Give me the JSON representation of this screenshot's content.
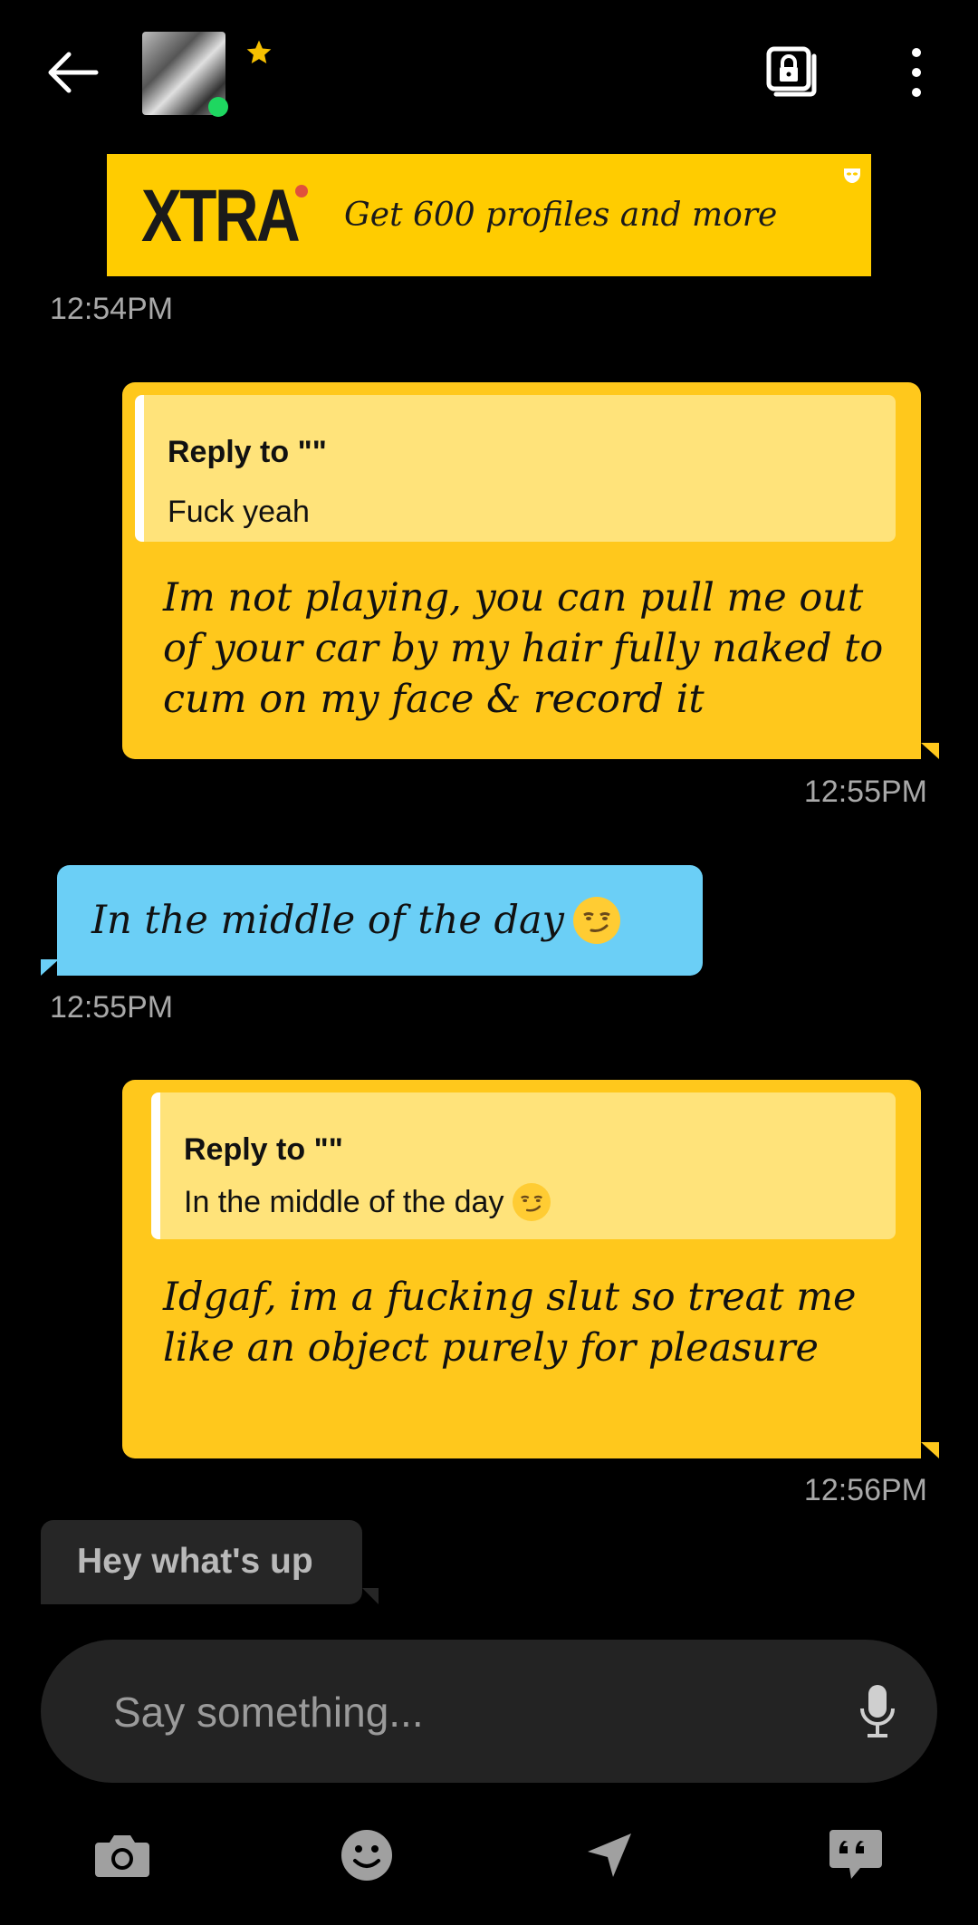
{
  "header": {
    "back_icon": "arrow-left-icon",
    "online_status_color": "#1ed760",
    "favorite_icon": "star-icon",
    "favorite_color": "#f7c000",
    "album_icon": "locked-album-icon",
    "more_icon": "more-vertical-icon"
  },
  "ad": {
    "logo": "XTRA",
    "text": "Get 600 profiles and more",
    "background": "#ffcc00"
  },
  "messages": [
    {
      "type": "ad_timestamp",
      "timestamp": "12:54PM"
    },
    {
      "direction": "outgoing",
      "reply_title": "Reply to \"\"",
      "reply_text": "Fuck yeah",
      "text": "Im not playing, you can pull me out of your car by my hair fully naked to cum on my face & record it",
      "timestamp": "12:55PM",
      "color": "#ffc81c"
    },
    {
      "direction": "incoming",
      "text": "In the middle of the day",
      "emoji": "smirk-emoji",
      "timestamp": "12:55PM",
      "color": "#6bcff6"
    },
    {
      "direction": "outgoing",
      "reply_title": "Reply to \"\"",
      "reply_text": "In the middle of the day",
      "reply_emoji": "smirk-emoji",
      "text": "Idgaf, im a fucking slut so treat me like an object purely for pleasure",
      "timestamp": "12:56PM",
      "color": "#ffc81c"
    },
    {
      "direction": "incoming",
      "text": "Hey what's up",
      "color": "#262626"
    }
  ],
  "composer": {
    "placeholder": "Say something...",
    "mic_icon": "microphone-icon"
  },
  "toolbar": {
    "items": [
      {
        "icon": "camera-icon"
      },
      {
        "icon": "smiley-icon"
      },
      {
        "icon": "location-arrow-icon"
      },
      {
        "icon": "saved-phrases-icon"
      }
    ]
  }
}
